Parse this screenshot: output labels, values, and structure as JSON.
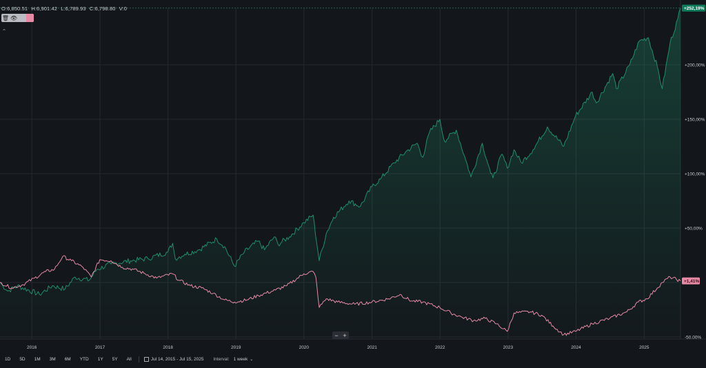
{
  "legend": {
    "open": "O:6,850.51",
    "high": "H:6,901.42",
    "low": "L:6,789.93",
    "close": "C:6,798.80",
    "volume": "V:0",
    "tool_icons": [
      "trash-icon",
      "eye-icon"
    ],
    "swatch_color": "#e88aa5"
  },
  "toolbar": {
    "ranges": [
      "1D",
      "5D",
      "1M",
      "3M",
      "6M",
      "YTD",
      "1Y",
      "5Y",
      "All"
    ],
    "date_range": "Jul 14, 2015 - Jul 15, 2025",
    "interval_label": "Interval:",
    "interval_value": "1 week"
  },
  "zoom": {
    "minus": "−",
    "plus": "+"
  },
  "colors": {
    "series_a": "#1f8f6a",
    "series_b": "#e88aa5",
    "badge_a_bg": "#0e7a5c",
    "badge_b_bg": "#e88aa5"
  },
  "chart_data": {
    "type": "line",
    "x_axis": {
      "type": "date",
      "range": [
        "2015-07-14",
        "2025-07-15"
      ],
      "tick_labels": [
        "2016",
        "2017",
        "2018",
        "2019",
        "2020",
        "2021",
        "2022",
        "2023",
        "2024",
        "2025"
      ],
      "tick_dates": [
        "2016-01-01",
        "2017-01-01",
        "2018-01-01",
        "2019-01-01",
        "2020-01-01",
        "2021-01-01",
        "2022-01-01",
        "2023-01-01",
        "2024-01-01",
        "2025-01-01"
      ]
    },
    "y_axis": {
      "unit": "percent",
      "range": [
        -52,
        252
      ],
      "tick_values": [
        200,
        150,
        100,
        50,
        0,
        -50
      ],
      "tick_labels": [
        "+200,00%",
        "+150,00%",
        "+100,00%",
        "+50,00%",
        "",
        "-50,00%"
      ]
    },
    "grid": true,
    "series": [
      {
        "badge": "+252,19%",
        "last_value": 252.19,
        "color": "#1f8f6a",
        "area": true,
        "points": [
          [
            "2015-07-14",
            0
          ],
          [
            "2015-08-25",
            -8
          ],
          [
            "2015-10-15",
            -3
          ],
          [
            "2016-02-11",
            -11
          ],
          [
            "2016-04-20",
            -3
          ],
          [
            "2016-06-27",
            -6
          ],
          [
            "2016-08-20",
            5
          ],
          [
            "2016-11-04",
            2
          ],
          [
            "2016-12-15",
            12
          ],
          [
            "2017-03-01",
            17
          ],
          [
            "2017-06-15",
            20
          ],
          [
            "2017-09-15",
            22
          ],
          [
            "2017-12-31",
            28
          ],
          [
            "2018-01-26",
            36
          ],
          [
            "2018-02-09",
            22
          ],
          [
            "2018-04-01",
            26
          ],
          [
            "2018-06-15",
            30
          ],
          [
            "2018-09-20",
            40
          ],
          [
            "2018-11-01",
            33
          ],
          [
            "2018-12-24",
            15
          ],
          [
            "2019-02-15",
            28
          ],
          [
            "2019-04-30",
            38
          ],
          [
            "2019-06-03",
            30
          ],
          [
            "2019-07-26",
            42
          ],
          [
            "2019-08-15",
            35
          ],
          [
            "2019-10-15",
            42
          ],
          [
            "2019-12-31",
            55
          ],
          [
            "2020-02-19",
            62
          ],
          [
            "2020-03-23",
            20
          ],
          [
            "2020-04-30",
            45
          ],
          [
            "2020-06-08",
            60
          ],
          [
            "2020-08-30",
            75
          ],
          [
            "2020-10-30",
            70
          ],
          [
            "2020-12-31",
            88
          ],
          [
            "2021-02-15",
            95
          ],
          [
            "2021-04-30",
            110
          ],
          [
            "2021-06-30",
            120
          ],
          [
            "2021-08-31",
            128
          ],
          [
            "2021-09-30",
            115
          ],
          [
            "2021-11-05",
            138
          ],
          [
            "2021-12-31",
            150
          ],
          [
            "2022-01-24",
            130
          ],
          [
            "2022-03-29",
            140
          ],
          [
            "2022-05-20",
            112
          ],
          [
            "2022-06-16",
            97
          ],
          [
            "2022-08-16",
            128
          ],
          [
            "2022-09-30",
            100
          ],
          [
            "2022-10-12",
            96
          ],
          [
            "2022-11-30",
            118
          ],
          [
            "2022-12-28",
            105
          ],
          [
            "2023-02-02",
            122
          ],
          [
            "2023-03-13",
            110
          ],
          [
            "2023-05-15",
            122
          ],
          [
            "2023-07-31",
            143
          ],
          [
            "2023-10-27",
            125
          ],
          [
            "2023-12-29",
            153
          ],
          [
            "2024-03-28",
            175
          ],
          [
            "2024-04-19",
            165
          ],
          [
            "2024-07-16",
            192
          ],
          [
            "2024-08-05",
            178
          ],
          [
            "2024-10-15",
            200
          ],
          [
            "2024-12-06",
            222
          ],
          [
            "2025-01-23",
            225
          ],
          [
            "2025-03-13",
            198
          ],
          [
            "2025-04-08",
            178
          ],
          [
            "2025-05-20",
            220
          ],
          [
            "2025-06-30",
            242
          ],
          [
            "2025-07-15",
            252.19
          ]
        ]
      },
      {
        "badge": "+1,41%",
        "last_value": 1.41,
        "color": "#e88aa5",
        "area": false,
        "points": [
          [
            "2015-07-14",
            0
          ],
          [
            "2015-09-15",
            -5
          ],
          [
            "2015-11-15",
            -2
          ],
          [
            "2016-01-15",
            4
          ],
          [
            "2016-03-15",
            10
          ],
          [
            "2016-05-01",
            12
          ],
          [
            "2016-06-15",
            24
          ],
          [
            "2016-08-01",
            20
          ],
          [
            "2016-10-01",
            14
          ],
          [
            "2016-11-15",
            5
          ],
          [
            "2016-12-31",
            21
          ],
          [
            "2017-03-01",
            20
          ],
          [
            "2017-05-01",
            14
          ],
          [
            "2017-07-01",
            12
          ],
          [
            "2017-09-01",
            8
          ],
          [
            "2017-11-01",
            4
          ],
          [
            "2018-01-26",
            8
          ],
          [
            "2018-03-01",
            2
          ],
          [
            "2018-05-01",
            -3
          ],
          [
            "2018-07-01",
            -5
          ],
          [
            "2018-09-01",
            -10
          ],
          [
            "2018-11-01",
            -16
          ],
          [
            "2018-12-24",
            -18
          ],
          [
            "2019-03-01",
            -16
          ],
          [
            "2019-05-01",
            -12
          ],
          [
            "2019-08-01",
            -7
          ],
          [
            "2019-10-01",
            -3
          ],
          [
            "2019-12-31",
            8
          ],
          [
            "2020-02-19",
            10
          ],
          [
            "2020-03-05",
            5
          ],
          [
            "2020-03-23",
            -23
          ],
          [
            "2020-04-30",
            -15
          ],
          [
            "2020-06-30",
            -18
          ],
          [
            "2020-09-30",
            -20
          ],
          [
            "2020-12-31",
            -18
          ],
          [
            "2021-03-31",
            -15
          ],
          [
            "2021-05-31",
            -11
          ],
          [
            "2021-07-31",
            -17
          ],
          [
            "2021-09-30",
            -18
          ],
          [
            "2021-12-31",
            -23
          ],
          [
            "2022-02-28",
            -28
          ],
          [
            "2022-04-30",
            -32
          ],
          [
            "2022-06-30",
            -35
          ],
          [
            "2022-08-31",
            -33
          ],
          [
            "2022-10-31",
            -38
          ],
          [
            "2022-12-28",
            -45
          ],
          [
            "2023-02-02",
            -28
          ],
          [
            "2023-04-30",
            -27
          ],
          [
            "2023-06-30",
            -30
          ],
          [
            "2023-08-31",
            -40
          ],
          [
            "2023-10-27",
            -48
          ],
          [
            "2023-12-29",
            -45
          ],
          [
            "2024-03-28",
            -38
          ],
          [
            "2024-06-30",
            -33
          ],
          [
            "2024-09-30",
            -27
          ],
          [
            "2024-11-30",
            -18
          ],
          [
            "2025-01-15",
            -15
          ],
          [
            "2025-03-13",
            -5
          ],
          [
            "2025-04-08",
            0
          ],
          [
            "2025-05-20",
            5
          ],
          [
            "2025-07-15",
            1.41
          ]
        ]
      }
    ]
  }
}
